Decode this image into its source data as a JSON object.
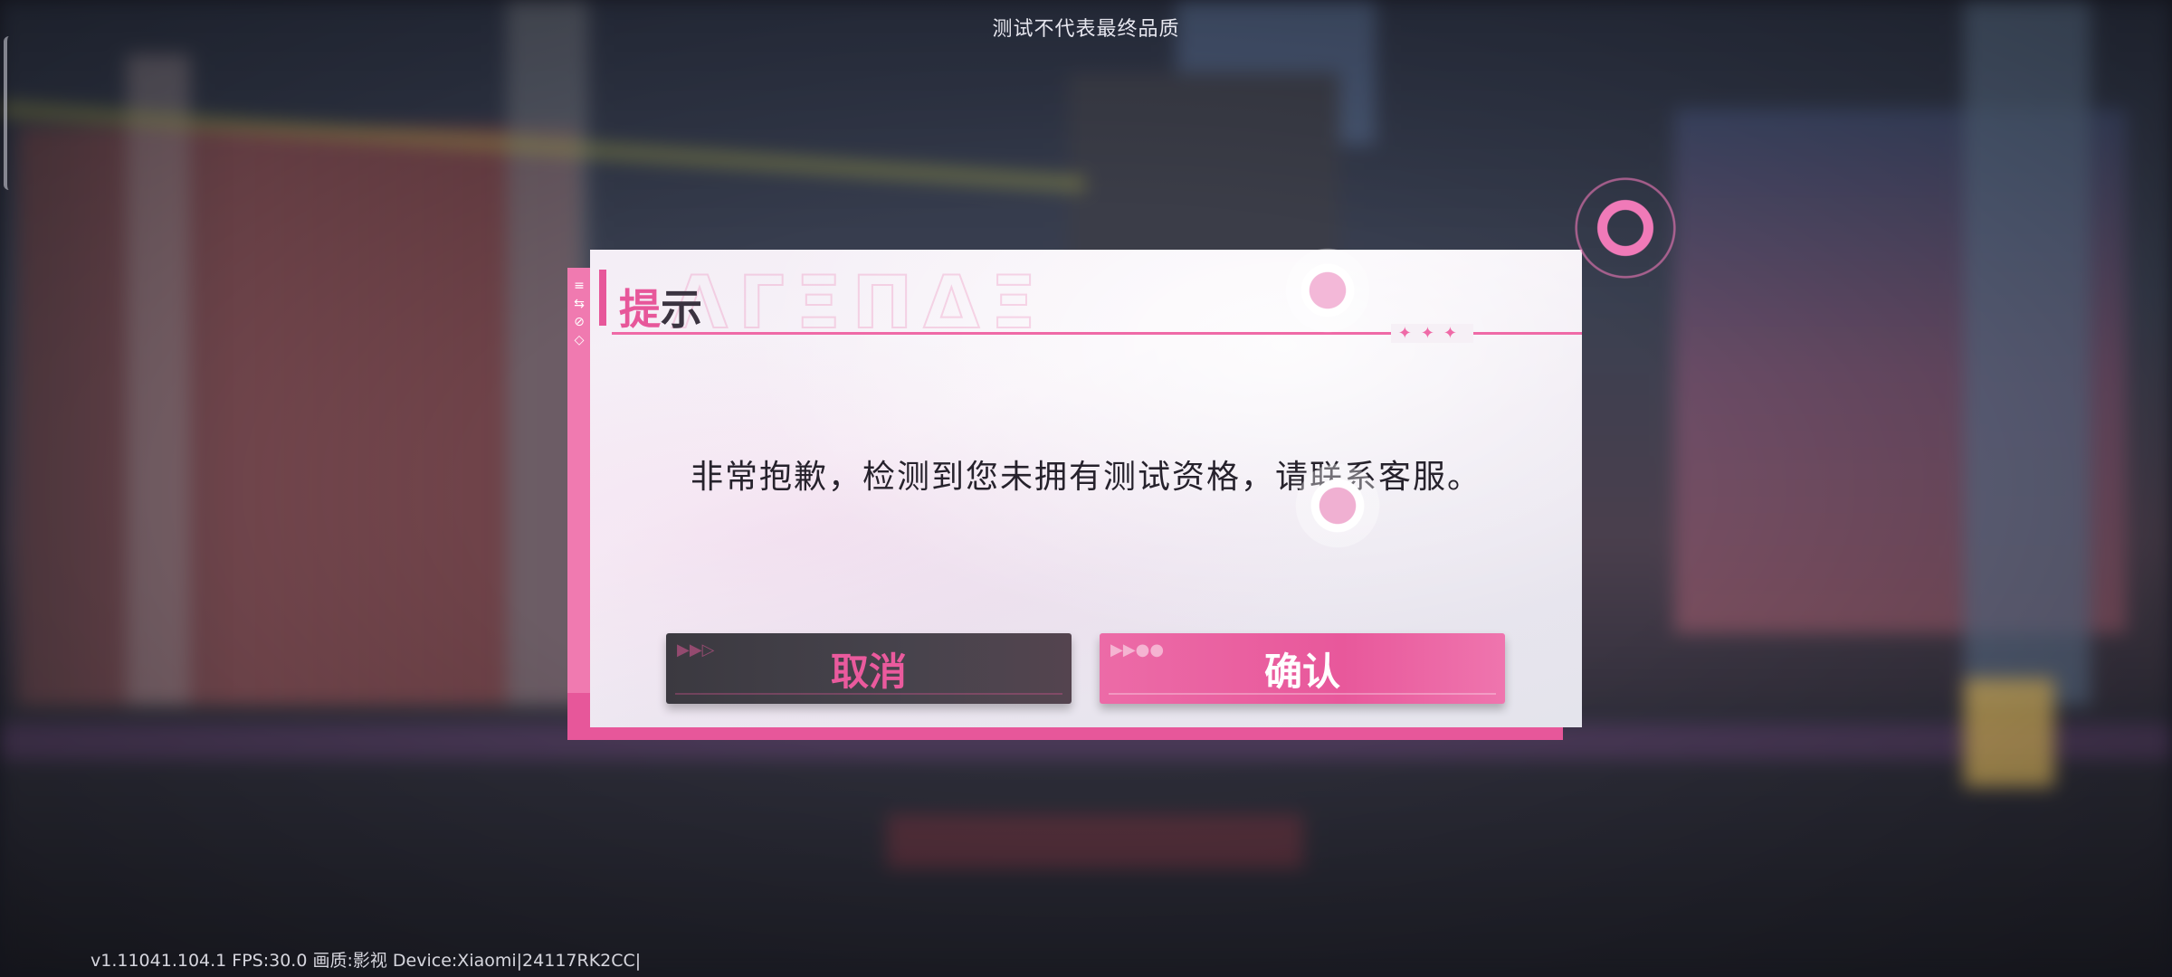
{
  "top_notice": "测试不代表最终品质",
  "version_info": "v1.11041.104.1 FPS:30.0 画质:影视 Device:Xiaomi|24117RK2CC|",
  "dialog": {
    "title_accent": "提",
    "title_rest": "示",
    "message": "非常抱歉，检测到您未拥有测试资格，请联系客服。",
    "cancel_label": "取消",
    "confirm_label": "确认"
  },
  "colors": {
    "accent_pink": "#e7579a",
    "cancel_bg": "#3b3940",
    "confirm_bg": "#ec6ba7"
  },
  "icons": [
    "play-arrows-icon",
    "ring-decoration-icon"
  ]
}
